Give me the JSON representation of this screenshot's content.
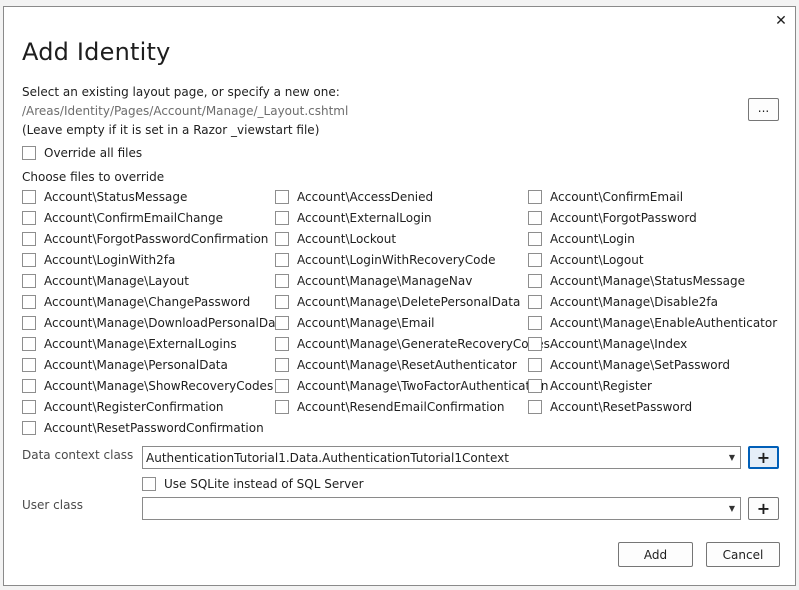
{
  "dialog": {
    "title": "Add Identity",
    "close_glyph": "✕",
    "layout_prompt": "Select an existing layout page, or specify a new one:",
    "layout_path": "/Areas/Identity/Pages/Account/Manage/_Layout.cshtml",
    "layout_hint": "(Leave empty if it is set in a Razor _viewstart file)",
    "browse_label": "...",
    "override_all_label": "Override all files",
    "choose_files_label": "Choose files to override",
    "files": [
      "Account\\StatusMessage",
      "Account\\AccessDenied",
      "Account\\ConfirmEmail",
      "Account\\ConfirmEmailChange",
      "Account\\ExternalLogin",
      "Account\\ForgotPassword",
      "Account\\ForgotPasswordConfirmation",
      "Account\\Lockout",
      "Account\\Login",
      "Account\\LoginWith2fa",
      "Account\\LoginWithRecoveryCode",
      "Account\\Logout",
      "Account\\Manage\\Layout",
      "Account\\Manage\\ManageNav",
      "Account\\Manage\\StatusMessage",
      "Account\\Manage\\ChangePassword",
      "Account\\Manage\\DeletePersonalData",
      "Account\\Manage\\Disable2fa",
      "Account\\Manage\\DownloadPersonalData",
      "Account\\Manage\\Email",
      "Account\\Manage\\EnableAuthenticator",
      "Account\\Manage\\ExternalLogins",
      "Account\\Manage\\GenerateRecoveryCodes",
      "Account\\Manage\\Index",
      "Account\\Manage\\PersonalData",
      "Account\\Manage\\ResetAuthenticator",
      "Account\\Manage\\SetPassword",
      "Account\\Manage\\ShowRecoveryCodes",
      "Account\\Manage\\TwoFactorAuthentication",
      "Account\\Register",
      "Account\\RegisterConfirmation",
      "Account\\ResendEmailConfirmation",
      "Account\\ResetPassword",
      "Account\\ResetPasswordConfirmation"
    ],
    "data_context_label": "Data context class",
    "data_context_value": "AuthenticationTutorial1.Data.AuthenticationTutorial1Context",
    "sqlite_label": "Use SQLite instead of SQL Server",
    "user_class_label": "User class",
    "user_class_value": "",
    "plus_label": "+",
    "add_label": "Add",
    "cancel_label": "Cancel"
  }
}
